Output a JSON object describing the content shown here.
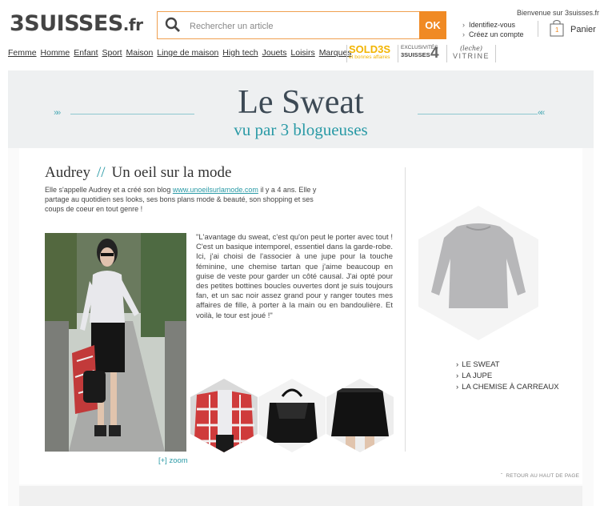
{
  "header": {
    "logo_main": "3SUISSES",
    "logo_tld": ".fr",
    "search_placeholder": "Rechercher un article",
    "search_button": "OK",
    "welcome": "Bienvenue sur 3suisses.fr",
    "account_links": [
      "Identifiez-vous",
      "Créez un compte"
    ],
    "cart_count": "1",
    "cart_label": "Panier",
    "accent_color": "#f08a24"
  },
  "nav": {
    "items": [
      "Femme",
      "Homme",
      "Enfant",
      "Sport",
      "Maison",
      "Linge de maison",
      "High tech",
      "Jouets",
      "Loisirs",
      "Marques"
    ],
    "soldes_big": "SOLD3S",
    "soldes_small": "et bonnes affaires",
    "exclusive_line1": "EXCLUSIVITÉS",
    "exclusive_line2": "3SUISSES",
    "exclusive_num": "4",
    "vitrine_line1": "(leche)",
    "vitrine_line2": "VITRINE"
  },
  "banner": {
    "title": "Le Sweat",
    "subtitle": "vu par 3 blogueuses"
  },
  "blogger": {
    "name": "Audrey",
    "separator": "//",
    "blog_title": "Un oeil sur la mode",
    "intro_before": "Elle s'appelle Audrey et a créé son blog ",
    "intro_link": "www.unoeilsurlamode.com",
    "intro_after": " il y a 4 ans. Elle y partage au quotidien ses looks, ses bons plans mode & beauté, son shopping et ses coups de coeur en tout genre !",
    "quote": "\"L'avantage du sweat, c'est qu'on peut le porter avec tout ! C'est un basique intemporel, essentiel dans la garde-robe. Ici, j'ai choisi de l'associer à une jupe pour la touche féminine, une chemise tartan que j'aime beaucoup en guise de veste pour garder un côté causal. J'ai opté pour des petites bottines boucles ouvertes dont je suis toujours fan, et un sac noir assez grand pour y ranger toutes mes affaires de fille, à porter à la main ou en bandoulière. Et voilà, le tour est joué !\"",
    "zoom": "[+] zoom"
  },
  "products": {
    "items": [
      "LE SWEAT",
      "LA JUPE",
      "LA CHEMISE À CARREAUX"
    ]
  },
  "back_to_top": "RETOUR AU HAUT DE PAGE"
}
